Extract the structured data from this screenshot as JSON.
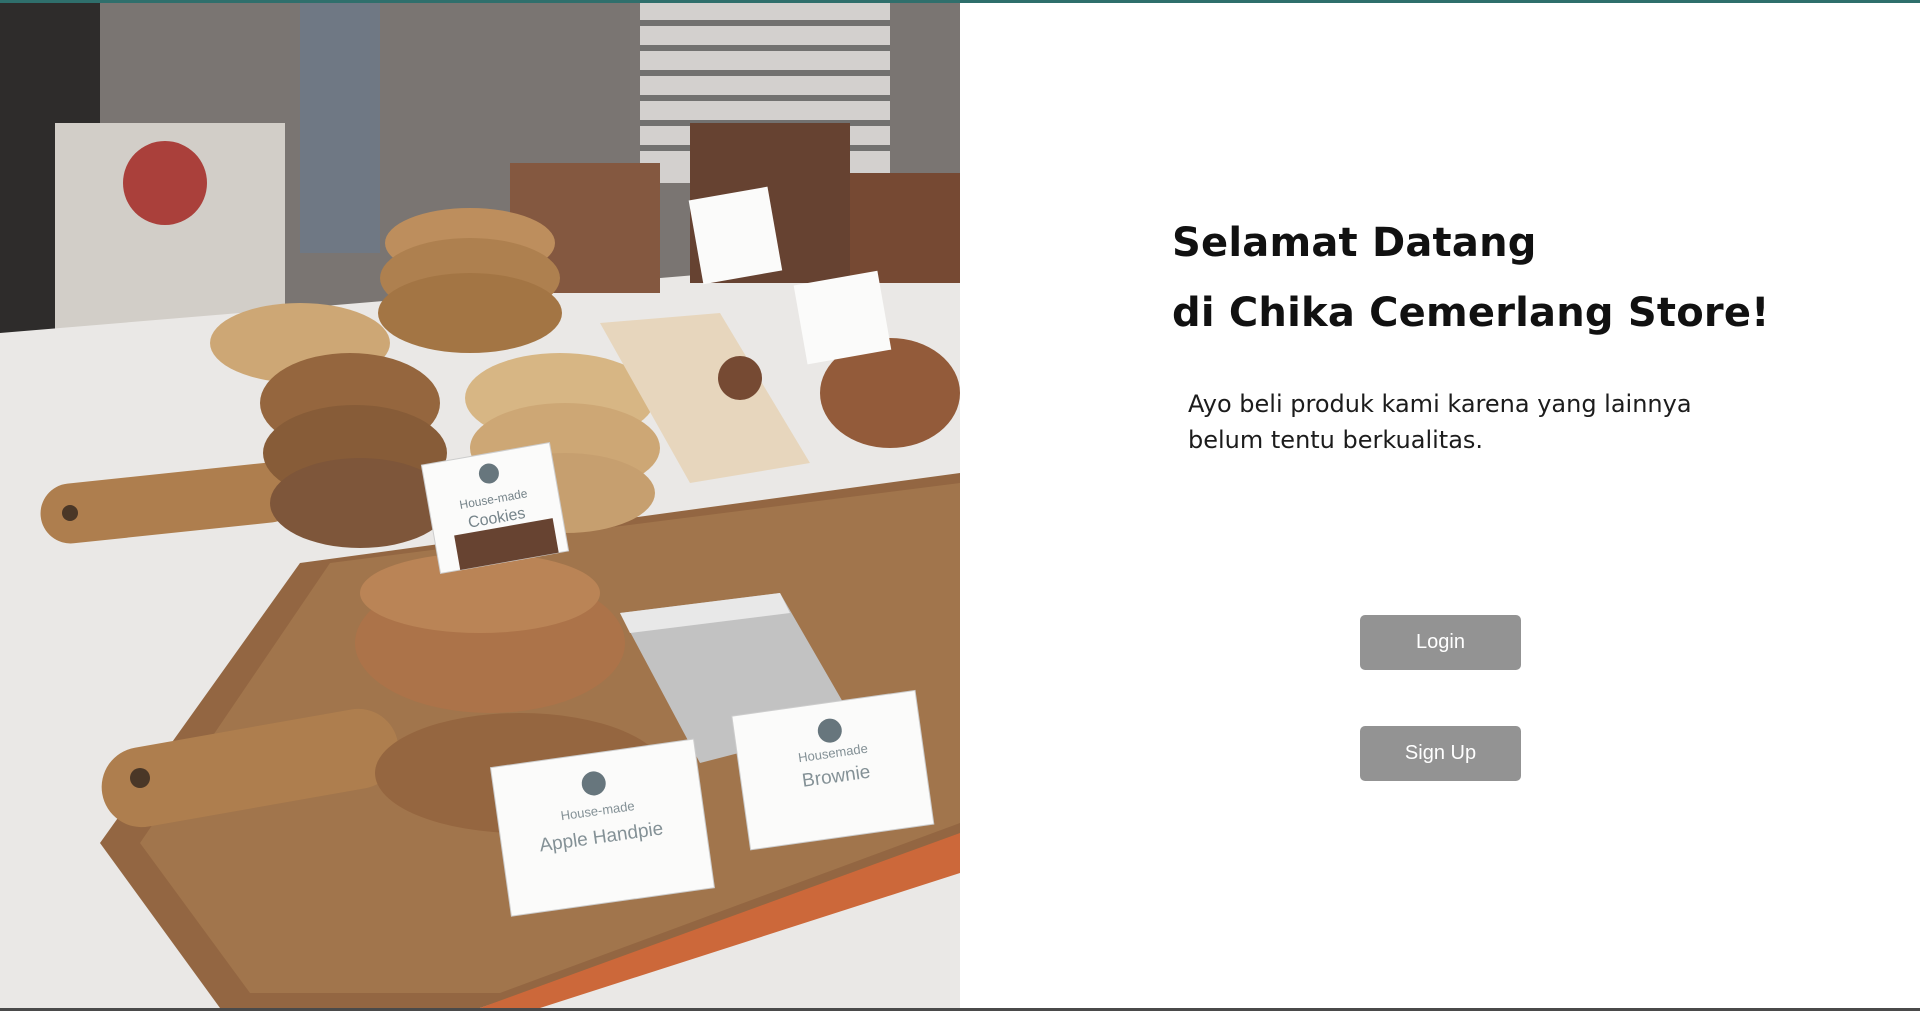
{
  "hero": {
    "image_alt": "Bakery display case with cookies, handpies and brownies",
    "labels": {
      "cookies_small": "House-made",
      "cookies": "Cookies",
      "handpie_small": "House-made",
      "handpie": "Apple Handpie",
      "brownie_small": "Housemade",
      "brownie": "Brownie"
    }
  },
  "welcome": {
    "title_line1": "Selamat Datang",
    "title_line2": "di Chika Cemerlang Store!",
    "subtitle": "Ayo beli produk kami karena yang lainnya belum tentu berkualitas."
  },
  "actions": {
    "login_label": "Login",
    "signup_label": "Sign Up"
  },
  "colors": {
    "button_bg": "#939393",
    "button_text": "#ffffff",
    "top_accent": "#2f6f6c"
  }
}
